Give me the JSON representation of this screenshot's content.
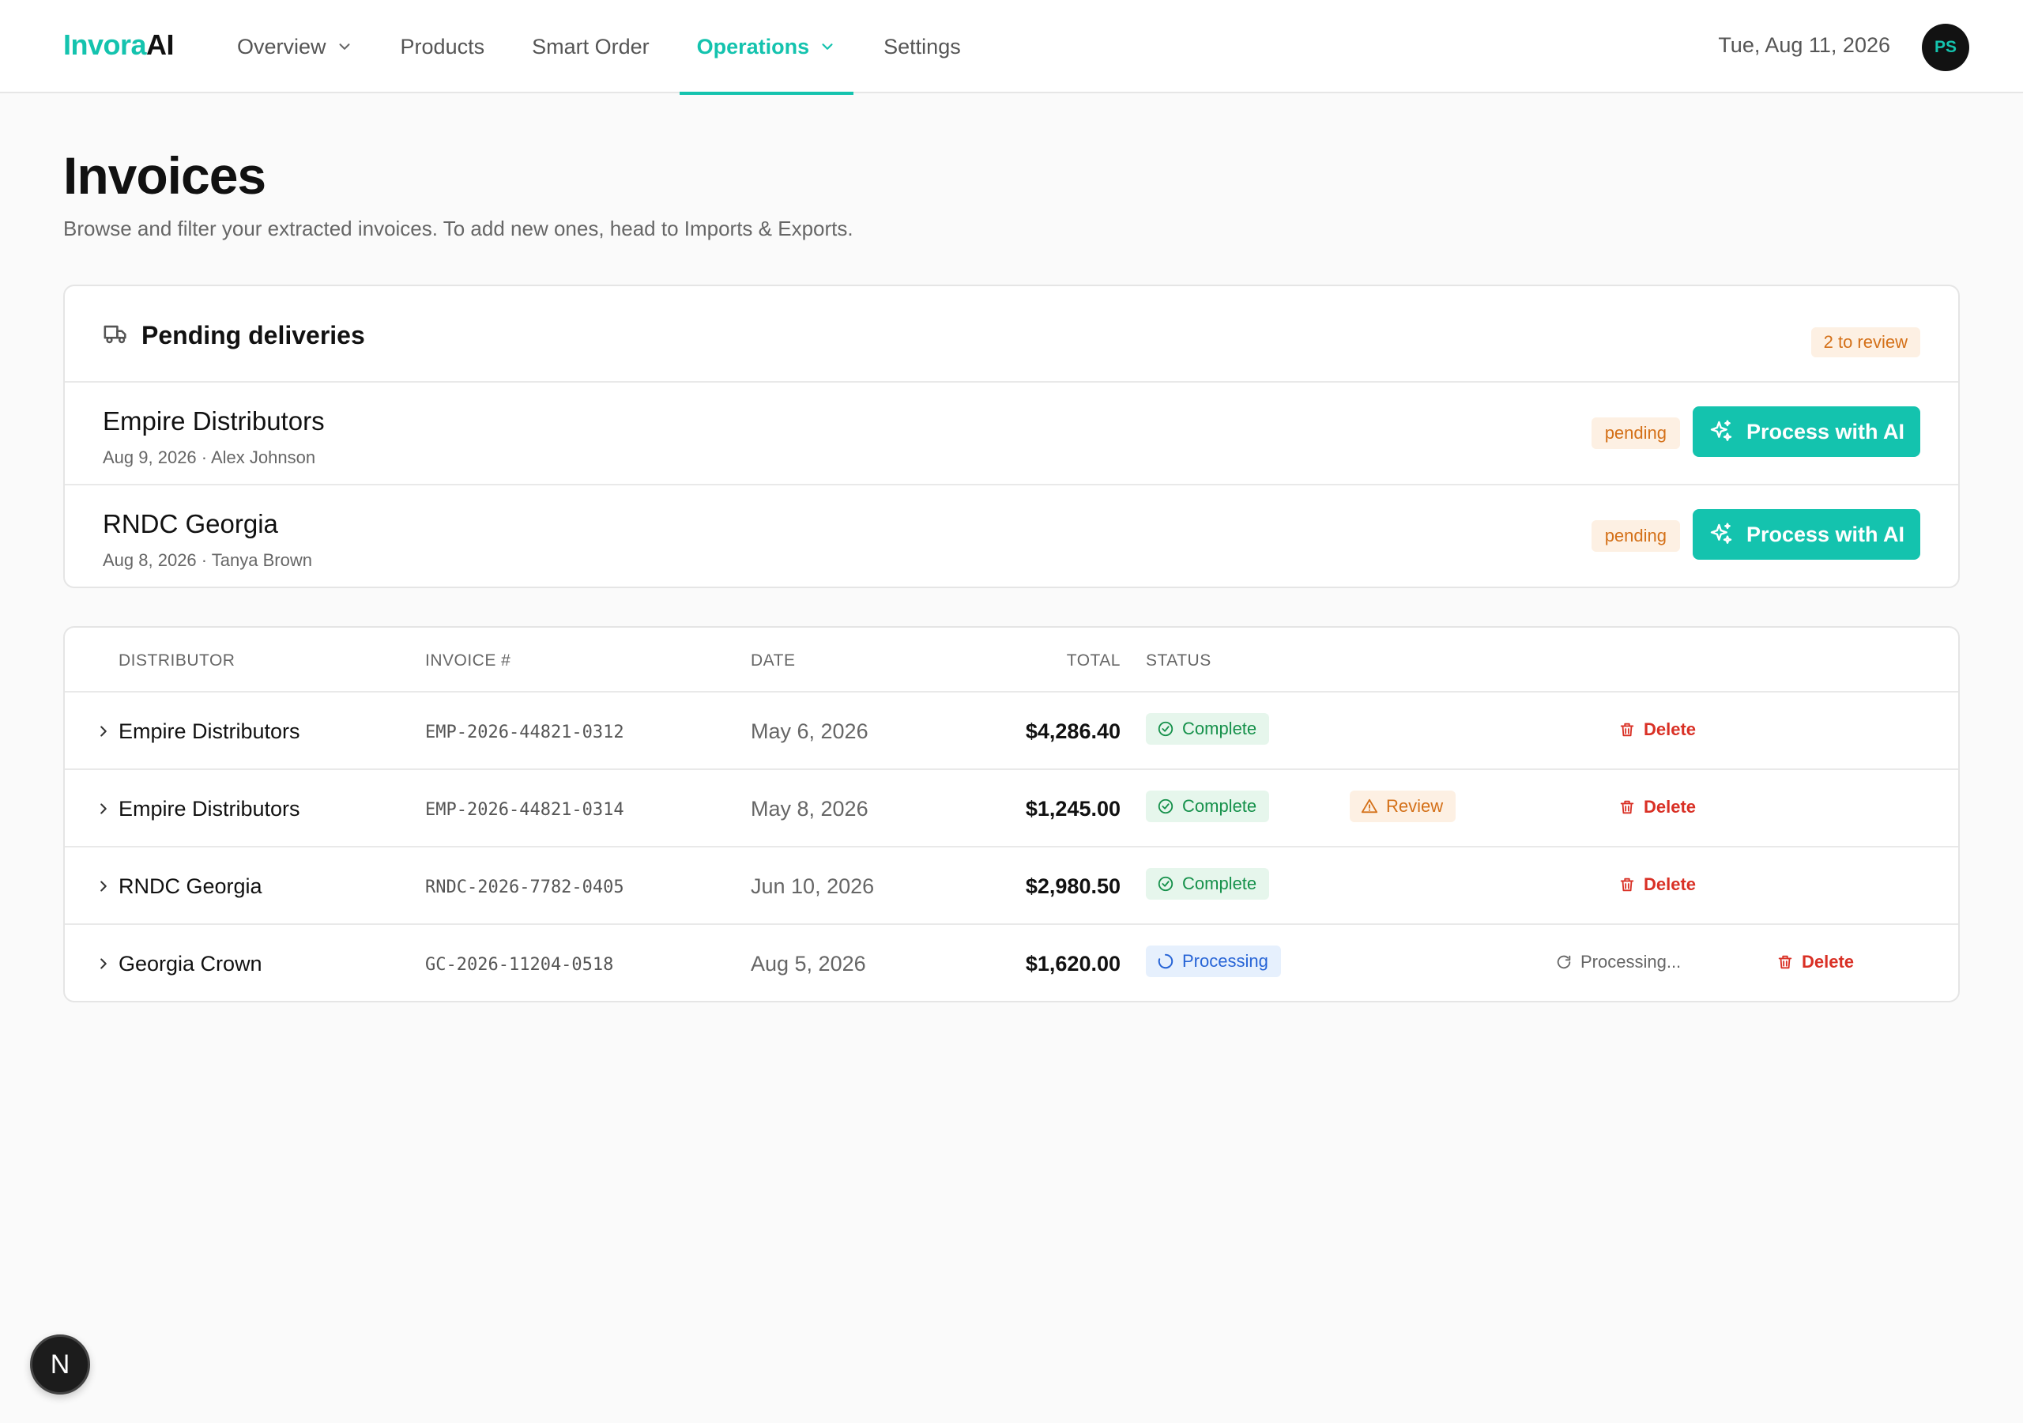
{
  "header": {
    "logo_part1": "Invora",
    "logo_part2": "AI",
    "nav": [
      {
        "label": "Overview",
        "has_dropdown": true,
        "active": false
      },
      {
        "label": "Products",
        "has_dropdown": false,
        "active": false
      },
      {
        "label": "Smart Order",
        "has_dropdown": false,
        "active": false
      },
      {
        "label": "Operations",
        "has_dropdown": true,
        "active": true
      },
      {
        "label": "Settings",
        "has_dropdown": false,
        "active": false
      }
    ],
    "date": "Tue, Aug 11, 2026",
    "avatar_initials": "PS"
  },
  "page": {
    "title": "Invoices",
    "subtitle": "Browse and filter your extracted invoices. To add new ones, head to Imports & Exports."
  },
  "pending": {
    "title": "Pending deliveries",
    "icon": "truck-icon",
    "review_badge": "2 to review",
    "items": [
      {
        "name": "Empire Distributors",
        "meta": "Aug 9, 2026 · Alex Johnson",
        "status": "pending",
        "action": "Process with AI"
      },
      {
        "name": "RNDC Georgia",
        "meta": "Aug 8, 2026 · Tanya Brown",
        "status": "pending",
        "action": "Process with AI"
      }
    ]
  },
  "table": {
    "headers": {
      "distributor": "DISTRIBUTOR",
      "invoice": "INVOICE #",
      "date": "DATE",
      "total": "TOTAL",
      "status": "STATUS"
    },
    "rows": [
      {
        "distributor": "Empire Distributors",
        "invoice": "EMP-2026-44821-0312",
        "date": "May 6, 2026",
        "total": "$4,286.40",
        "status": "Complete",
        "extra": "",
        "processing": "",
        "delete": "Delete"
      },
      {
        "distributor": "Empire Distributors",
        "invoice": "EMP-2026-44821-0314",
        "date": "May 8, 2026",
        "total": "$1,245.00",
        "status": "Complete",
        "extra": "Review",
        "processing": "",
        "delete": "Delete"
      },
      {
        "distributor": "RNDC Georgia",
        "invoice": "RNDC-2026-7782-0405",
        "date": "Jun 10, 2026",
        "total": "$2,980.50",
        "status": "Complete",
        "extra": "",
        "processing": "",
        "delete": "Delete"
      },
      {
        "distributor": "Georgia Crown",
        "invoice": "GC-2026-11204-0518",
        "date": "Aug 5, 2026",
        "total": "$1,620.00",
        "status": "Processing",
        "extra": "",
        "processing": "Processing...",
        "delete": "Delete"
      }
    ]
  },
  "fab": {
    "label": "N"
  },
  "colors": {
    "accent": "#14c3ae",
    "pending": "#d47018",
    "complete": "#16914b",
    "processing": "#2764d6",
    "danger": "#d93025"
  }
}
